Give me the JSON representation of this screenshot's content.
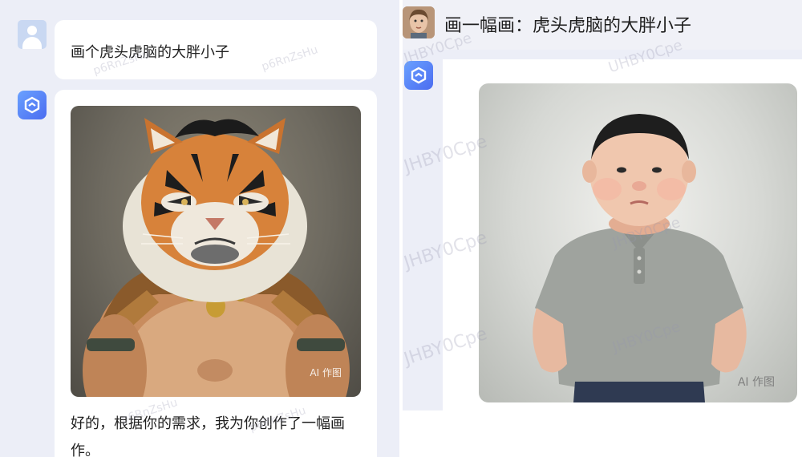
{
  "left_chat": {
    "user_message": "画个虎头虎脑的大胖小子",
    "bot_image_label": "AI 作图",
    "bot_reply": "好的，根据你的需求，我为你创作了一幅画作。",
    "watermark": "p6RnZsHu"
  },
  "right_chat": {
    "prompt_title": "画一幅画：虎头虎脑的大胖小子",
    "bot_image_label": "AI 作图",
    "watermark": "JHBY0Cpe",
    "watermark_alt": "UHBY0Cpe"
  },
  "colors": {
    "background": "#eceef7",
    "bubble": "#ffffff",
    "bot_logo_start": "#6aa1ff",
    "bot_logo_end": "#4b6cf0",
    "text": "#1f1f1f"
  },
  "icons": [
    "user-avatar-icon",
    "bot-logo-icon",
    "photo-avatar"
  ]
}
